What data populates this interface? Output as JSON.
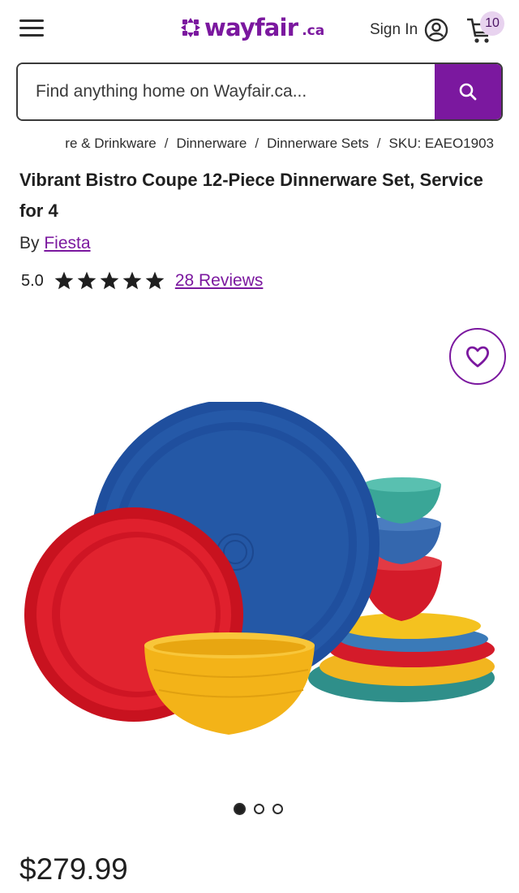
{
  "header": {
    "logo_text": "wayfair",
    "logo_suffix": ".ca",
    "sign_in_label": "Sign In",
    "cart_count": "10"
  },
  "search": {
    "placeholder": "Find anything home on Wayfair.ca..."
  },
  "breadcrumb": {
    "items": [
      "re & Drinkware",
      "Dinnerware",
      "Dinnerware Sets"
    ],
    "sku": "SKU: EAEO1903"
  },
  "product": {
    "title": "Vibrant Bistro Coupe 12-Piece Dinnerware Set, Service for 4",
    "brand_prefix": "By",
    "brand": "Fiesta",
    "rating": "5.0",
    "stars": 5,
    "reviews_label": "28 Reviews",
    "price": "$279.99"
  },
  "carousel": {
    "total": 3,
    "active_index": 0
  },
  "colors": {
    "brand_purple": "#7b189f",
    "badge_bg": "#e8d3ef"
  },
  "icons": {
    "menu": "hamburger-menu-icon",
    "account": "account-icon",
    "cart": "cart-icon",
    "search": "search-icon",
    "favorite": "heart-icon",
    "star": "star-icon"
  }
}
